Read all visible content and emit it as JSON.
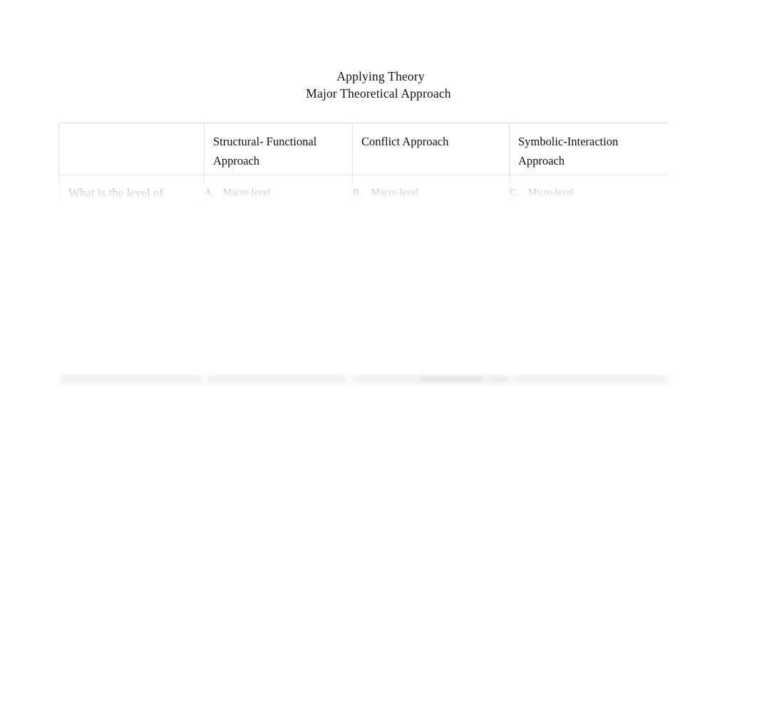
{
  "document": {
    "title_line_1": "Applying Theory",
    "title_line_2": "Major Theoretical Approach"
  },
  "table": {
    "columns": [
      {
        "key": "question",
        "header": ""
      },
      {
        "key": "structural_functional",
        "header": "Structural- Functional Approach"
      },
      {
        "key": "conflict",
        "header": "Conflict Approach"
      },
      {
        "key": "symbolic_interaction",
        "header": "Symbolic-Interaction Approach"
      }
    ],
    "rows": [
      {
        "question": "What is the level of",
        "answers": {
          "structural_functional": {
            "marker": "A.",
            "text": "Macro-level"
          },
          "conflict": {
            "marker": "B.",
            "text": "Macro-level"
          },
          "symbolic_interaction": {
            "marker": "C.",
            "text": "Micro-level"
          }
        }
      }
    ]
  },
  "colors": {
    "page_background": "#ffffff",
    "text": "#111111",
    "table_border": "#dedede",
    "cell_background": "#ffffff",
    "ghost_line": "#f0f0f0"
  }
}
